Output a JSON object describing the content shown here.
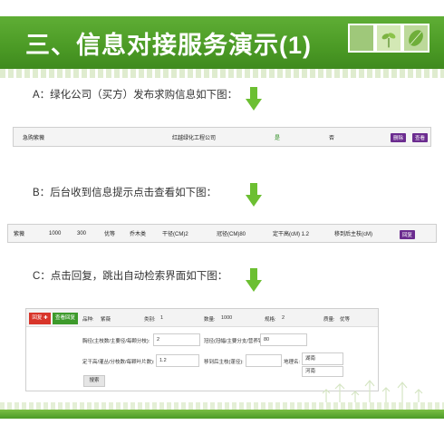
{
  "title": "三、信息对接服务演示(1)",
  "steps": [
    {
      "label": "A：绿化公司（买方）发布求购信息如下图："
    },
    {
      "label": "B：后台收到信息提示点击查看如下图："
    },
    {
      "label": "C：点击回复，跳出自动检索界面如下图："
    }
  ],
  "panel1": {
    "cells": [
      "急购紫薇",
      "红越绿化工程公司",
      "是",
      "否"
    ],
    "btn_delete": "删除",
    "btn_view": "查看"
  },
  "panel2": {
    "cells": [
      "紫薇",
      "1000",
      "300",
      "优等",
      "乔木类",
      "干径(CM)2",
      "冠径(CM)80",
      "定干高(cM) 1.2",
      "移到后主枝(cM)"
    ],
    "btn_reply": "回复"
  },
  "panel3": {
    "btn_reply": "回复",
    "btn_view_reply": "查看回复",
    "row1": {
      "product_label": "品种:",
      "product_value": "紫薇",
      "category_label": "类别:",
      "category_value": "1",
      "qty_label": "数量:",
      "qty_value": "1000",
      "spec_label": "规格:",
      "spec_value": "2",
      "quality_label": "质量:",
      "quality_value": "优等"
    },
    "row2": {
      "label1": "胸径(主枝数/主要径/每颗分枝):",
      "value1": "2",
      "label2": "冠径(冠幅/主要分支/营养钵径):",
      "value2": "80"
    },
    "row3": {
      "label1": "定干高/灌丛/分枝数/每颗叶片数):",
      "value1": "1.2",
      "label2": "移到后主枝(蓬径):",
      "label3": "地理名:",
      "value3": "湖南",
      "value4": "河南"
    },
    "search_btn": "搜索"
  }
}
